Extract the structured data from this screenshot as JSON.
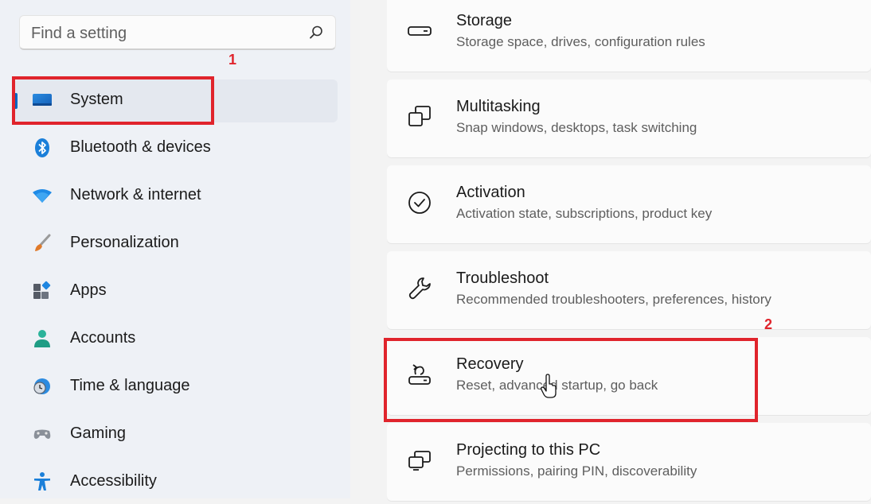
{
  "search": {
    "placeholder": "Find a setting",
    "icon": "search-icon"
  },
  "sidebar": {
    "items": [
      {
        "label": "System",
        "icon": "system-display-icon",
        "selected": true
      },
      {
        "label": "Bluetooth & devices",
        "icon": "bluetooth-icon"
      },
      {
        "label": "Network & internet",
        "icon": "wifi-icon"
      },
      {
        "label": "Personalization",
        "icon": "paintbrush-icon"
      },
      {
        "label": "Apps",
        "icon": "apps-icon"
      },
      {
        "label": "Accounts",
        "icon": "person-icon"
      },
      {
        "label": "Time & language",
        "icon": "clock-globe-icon"
      },
      {
        "label": "Gaming",
        "icon": "gamepad-icon"
      },
      {
        "label": "Accessibility",
        "icon": "accessibility-icon"
      }
    ]
  },
  "settings": [
    {
      "title": "Storage",
      "subtitle": "Storage space, drives, configuration rules",
      "icon": "storage-drive-icon"
    },
    {
      "title": "Multitasking",
      "subtitle": "Snap windows, desktops, task switching",
      "icon": "multitasking-icon"
    },
    {
      "title": "Activation",
      "subtitle": "Activation state, subscriptions, product key",
      "icon": "activation-check-icon"
    },
    {
      "title": "Troubleshoot",
      "subtitle": "Recommended troubleshooters, preferences, history",
      "icon": "wrench-icon"
    },
    {
      "title": "Recovery",
      "subtitle": "Reset, advanced startup, go back",
      "icon": "recovery-icon"
    },
    {
      "title": "Projecting to this PC",
      "subtitle": "Permissions, pairing PIN, discoverability",
      "icon": "projecting-icon"
    }
  ],
  "annotations": {
    "step1": "1",
    "step2": "2"
  },
  "colors": {
    "accent": "#0067c0",
    "annotation": "#e0242c"
  }
}
